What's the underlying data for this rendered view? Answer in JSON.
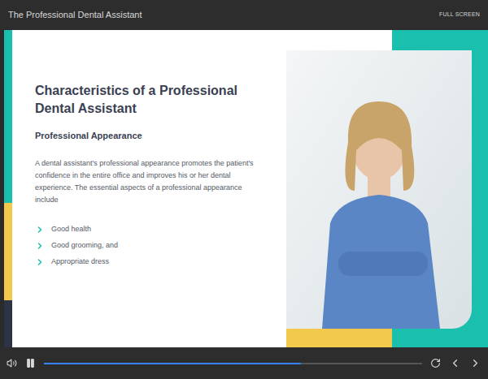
{
  "window": {
    "title": "The Professional Dental Assistant",
    "action": "FULL SCREEN"
  },
  "slide": {
    "title": "Characteristics of a Professional Dental Assistant",
    "subtitle": "Professional Appearance",
    "paragraph": "A dental assistant's professional appearance promotes the patient's confidence in the entire office and improves his or her dental experience. The essential aspects of a professional appearance include",
    "bullets": [
      "Good health",
      "Good grooming, and",
      "Appropriate dress"
    ]
  },
  "player": {
    "playing": true,
    "progress": 0.68
  }
}
